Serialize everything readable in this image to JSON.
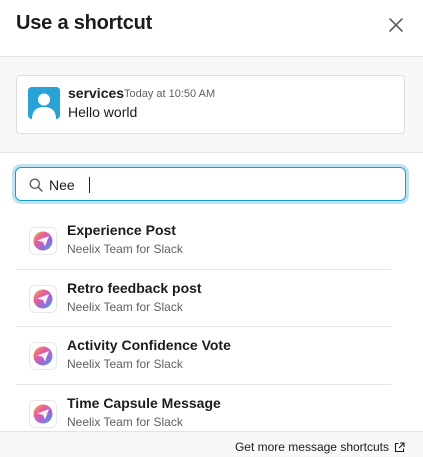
{
  "dialog": {
    "title": "Use a shortcut"
  },
  "message": {
    "author": "services",
    "time": "Today at 10:50 AM",
    "text": "Hello world"
  },
  "search": {
    "value": "Nee",
    "placeholder": ""
  },
  "results": [
    {
      "name": "Experience Post",
      "app": "Neelix Team for Slack",
      "icon": "neelix-app-icon"
    },
    {
      "name": "Retro feedback post",
      "app": "Neelix Team for Slack",
      "icon": "neelix-app-icon"
    },
    {
      "name": "Activity Confidence Vote",
      "app": "Neelix Team for Slack",
      "icon": "neelix-app-icon"
    },
    {
      "name": "Time Capsule Message",
      "app": "Neelix Team for Slack",
      "icon": "neelix-app-icon"
    }
  ],
  "footer": {
    "link_label": "Get more message shortcuts"
  },
  "colors": {
    "focus_ring": "#1d9bd1",
    "avatar_bg": "#29a3d6"
  }
}
